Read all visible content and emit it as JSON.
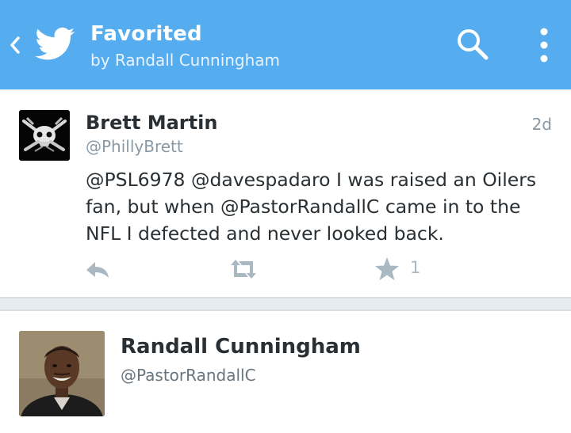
{
  "actionbar": {
    "title": "Favorited",
    "subtitle": "by Randall Cunningham",
    "color": "#55acee",
    "icons": [
      "back-icon",
      "twitter-bird-icon",
      "search-icon",
      "overflow-menu-icon"
    ]
  },
  "tweet": {
    "author_name": "Brett Martin",
    "author_handle": "@PhillyBrett",
    "time": "2d",
    "text": "@PSL6978 @davespadaro I was raised an Oilers fan, but when @PastorRandallC came in to the NFL I defected and never looked back.",
    "favorite_count": "1",
    "actions": [
      "reply-icon",
      "retweet-icon",
      "favorite-icon"
    ]
  },
  "user_card": {
    "name": "Randall Cunningham",
    "handle": "@PastorRandallC"
  }
}
